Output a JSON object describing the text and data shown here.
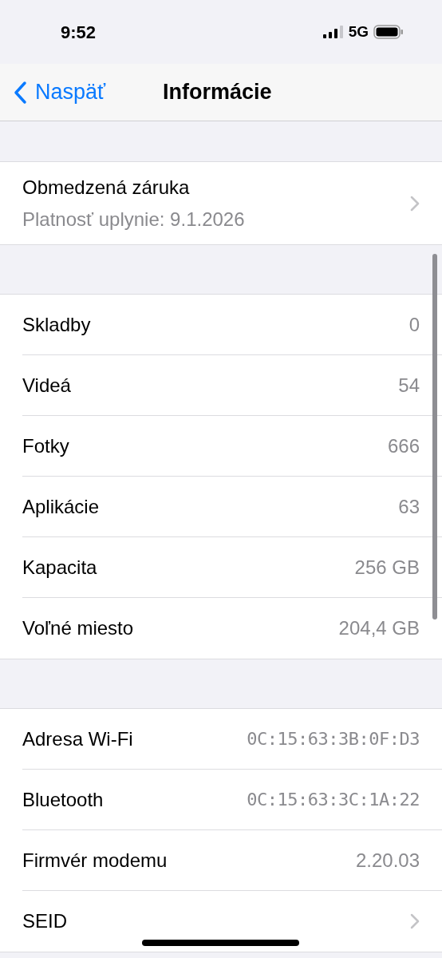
{
  "status_bar": {
    "time": "9:52",
    "network": "5G"
  },
  "nav": {
    "back": "Naspäť",
    "title": "Informácie"
  },
  "warranty": {
    "title": "Obmedzená záruka",
    "subtitle": "Platnosť uplynie: 9.1.2026"
  },
  "sections": [
    {
      "rows": [
        {
          "kind": "value",
          "label": "Skladby",
          "value": "0"
        },
        {
          "kind": "value",
          "label": "Videá",
          "value": "54"
        },
        {
          "kind": "value",
          "label": "Fotky",
          "value": "666"
        },
        {
          "kind": "value",
          "label": "Aplikácie",
          "value": "63"
        },
        {
          "kind": "value",
          "label": "Kapacita",
          "value": "256 GB"
        },
        {
          "kind": "value",
          "label": "Voľné miesto",
          "value": "204,4 GB"
        }
      ]
    },
    {
      "rows": [
        {
          "kind": "mono",
          "label": "Adresa Wi-Fi",
          "value": "0C:15:63:3B:0F:D3"
        },
        {
          "kind": "mono",
          "label": "Bluetooth",
          "value": "0C:15:63:3C:1A:22"
        },
        {
          "kind": "value",
          "label": "Firmvér modemu",
          "value": "2.20.03"
        },
        {
          "kind": "link",
          "label": "SEID"
        }
      ]
    }
  ]
}
